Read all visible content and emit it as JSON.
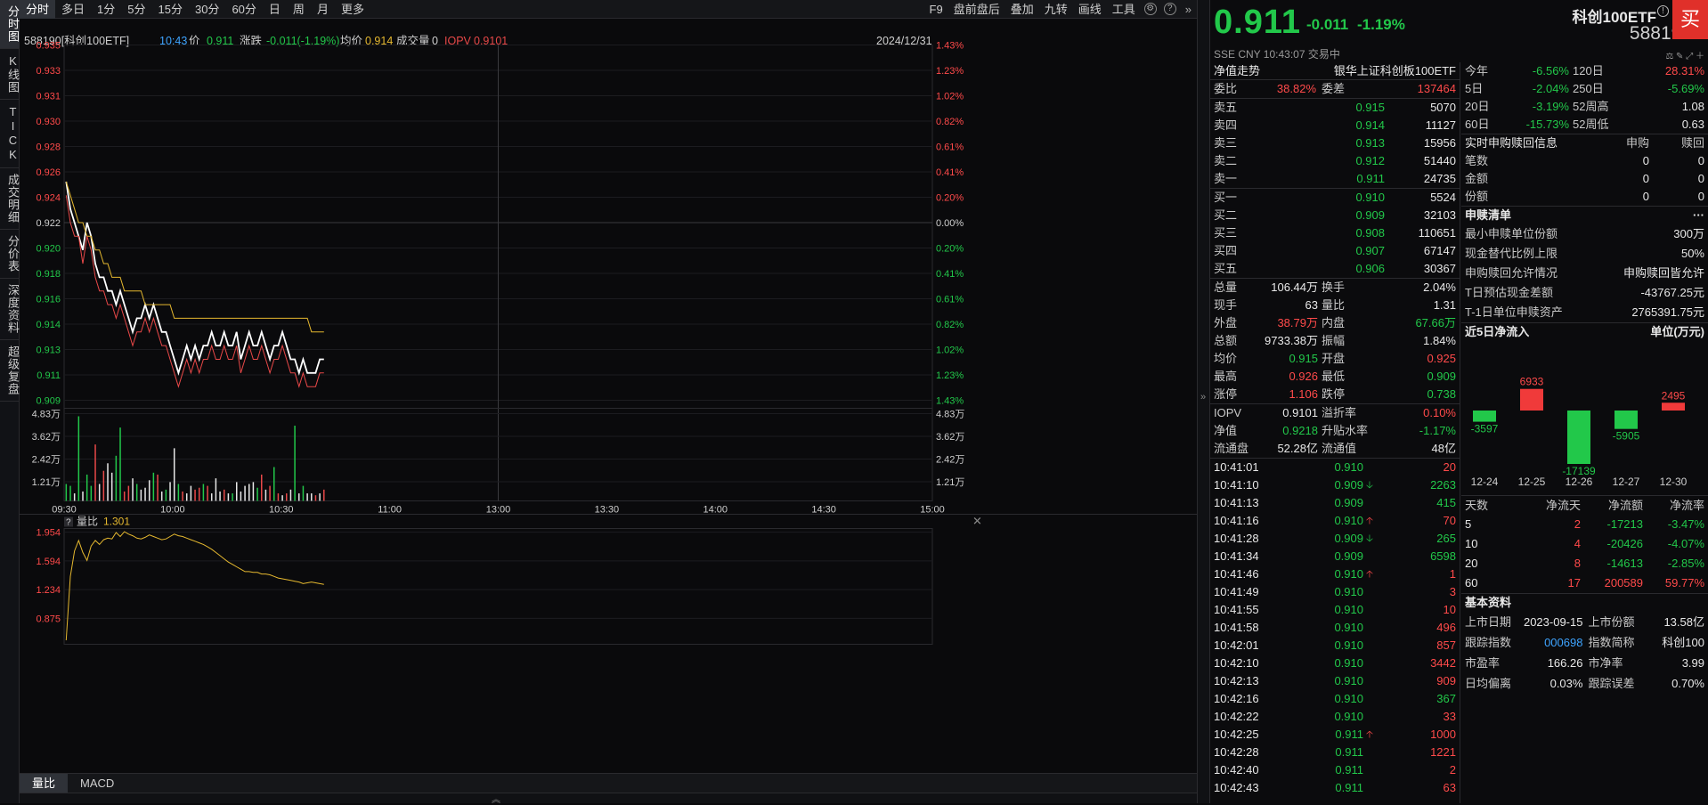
{
  "nav_left": [
    "分时图",
    "K线图",
    "TICK",
    "成交明细",
    "分价表",
    "深度资料",
    "超级复盘"
  ],
  "toolbar": {
    "periods": [
      "分时",
      "多日",
      "1分",
      "5分",
      "15分",
      "30分",
      "60分",
      "日",
      "周",
      "月",
      "更多"
    ],
    "right": [
      "F9",
      "盘前盘后",
      "叠加",
      "九转",
      "画线",
      "工具"
    ]
  },
  "infobar": {
    "code_name": "588190[科创100ETF]",
    "time": "10:43",
    "price_label": "价",
    "price": "0.911",
    "chg_label": "涨跌",
    "chg": "-0.011(-1.19%)",
    "avg_label": "均价",
    "avg": "0.914",
    "vol_label": "成交量",
    "vol": "0",
    "iopv_label": "IOPV",
    "iopv": "0.9101",
    "date": "2024/12/31"
  },
  "chart_data": [
    {
      "type": "line",
      "title": "分时",
      "y_left_ticks": [
        "0.935",
        "0.933",
        "0.931",
        "0.930",
        "0.928",
        "0.926",
        "0.924",
        "0.922",
        "0.920",
        "0.918",
        "0.916",
        "0.914",
        "0.913",
        "0.911",
        "0.909"
      ],
      "y_right_ticks": [
        "1.43%",
        "1.23%",
        "1.02%",
        "0.82%",
        "0.61%",
        "0.41%",
        "0.20%",
        "0.00%",
        "0.20%",
        "0.41%",
        "0.61%",
        "0.82%",
        "1.02%",
        "1.23%",
        "1.43%"
      ],
      "x_ticks": [
        "09:30",
        "10:00",
        "10:30",
        "11:00",
        "13:00",
        "13:30",
        "14:00",
        "14:30",
        "15:00"
      ],
      "ylim": [
        0.909,
        0.935
      ],
      "prev_close": 0.922,
      "series": [
        {
          "name": "价",
          "color": "#ffffff",
          "values": [
            0.925,
            0.923,
            0.922,
            0.921,
            0.92,
            0.922,
            0.921,
            0.919,
            0.918,
            0.918,
            0.917,
            0.917,
            0.916,
            0.917,
            0.916,
            0.915,
            0.914,
            0.915,
            0.915,
            0.916,
            0.915,
            0.916,
            0.915,
            0.914,
            0.914,
            0.913,
            0.912,
            0.911,
            0.912,
            0.913,
            0.912,
            0.913,
            0.912,
            0.913,
            0.913,
            0.914,
            0.913,
            0.913,
            0.914,
            0.913,
            0.913,
            0.914,
            0.912,
            0.913,
            0.914,
            0.913,
            0.913,
            0.914,
            0.913,
            0.912,
            0.913,
            0.913,
            0.914,
            0.913,
            0.912,
            0.912,
            0.911,
            0.912,
            0.911,
            0.911,
            0.911,
            0.912,
            0.912
          ]
        },
        {
          "name": "均价",
          "color": "#e5b82f",
          "values": [
            0.925,
            0.924,
            0.923,
            0.922,
            0.922,
            0.921,
            0.921,
            0.92,
            0.92,
            0.919,
            0.919,
            0.918,
            0.918,
            0.918,
            0.917,
            0.917,
            0.917,
            0.917,
            0.917,
            0.916,
            0.916,
            0.916,
            0.916,
            0.916,
            0.916,
            0.916,
            0.915,
            0.915,
            0.915,
            0.915,
            0.915,
            0.915,
            0.915,
            0.915,
            0.915,
            0.915,
            0.915,
            0.915,
            0.915,
            0.915,
            0.915,
            0.915,
            0.915,
            0.915,
            0.915,
            0.915,
            0.915,
            0.915,
            0.915,
            0.915,
            0.915,
            0.915,
            0.915,
            0.915,
            0.915,
            0.915,
            0.915,
            0.915,
            0.915,
            0.914,
            0.914,
            0.914,
            0.914
          ]
        },
        {
          "name": "IOPV",
          "color": "#e84848",
          "values": [
            0.924,
            0.922,
            0.921,
            0.921,
            0.919,
            0.921,
            0.92,
            0.918,
            0.917,
            0.917,
            0.916,
            0.916,
            0.915,
            0.916,
            0.915,
            0.914,
            0.913,
            0.914,
            0.914,
            0.915,
            0.914,
            0.915,
            0.914,
            0.913,
            0.913,
            0.912,
            0.911,
            0.91,
            0.911,
            0.912,
            0.911,
            0.912,
            0.911,
            0.912,
            0.912,
            0.913,
            0.912,
            0.912,
            0.913,
            0.912,
            0.912,
            0.913,
            0.911,
            0.912,
            0.913,
            0.912,
            0.912,
            0.913,
            0.912,
            0.911,
            0.912,
            0.912,
            0.913,
            0.912,
            0.911,
            0.911,
            0.91,
            0.911,
            0.91,
            0.91,
            0.91,
            0.911,
            0.911
          ]
        }
      ],
      "volume": {
        "y_ticks": [
          "4.83万",
          "3.62万",
          "2.42万",
          "1.21万"
        ],
        "ylim": [
          0,
          48300
        ],
        "values": [
          9000,
          8000,
          4000,
          45000,
          5000,
          14000,
          8000,
          30000,
          9000,
          16000,
          20000,
          15000,
          24000,
          39000,
          5000,
          8000,
          12000,
          9000,
          6000,
          7000,
          11000,
          15000,
          14000,
          5000,
          6000,
          10000,
          28000,
          9000,
          5000,
          4000,
          8000,
          6000,
          7000,
          9000,
          8000,
          4000,
          12000,
          5000,
          6000,
          4000,
          4000,
          10000,
          5000,
          8000,
          9000,
          10000,
          7000,
          14000,
          6000,
          8000,
          18000,
          4000,
          3000,
          4000,
          6000,
          40000,
          4000,
          8000,
          4000,
          4000,
          3000,
          4000,
          6000
        ],
        "colors": [
          "g",
          "g",
          "w",
          "g",
          "w",
          "g",
          "g",
          "r",
          "w",
          "r",
          "w",
          "w",
          "g",
          "g",
          "r",
          "r",
          "w",
          "g",
          "w",
          "w",
          "w",
          "g",
          "r",
          "w",
          "g",
          "w",
          "w",
          "g",
          "r",
          "w",
          "w",
          "r",
          "r",
          "g",
          "r",
          "w",
          "w",
          "w",
          "r",
          "w",
          "g",
          "w",
          "w",
          "w",
          "w",
          "w",
          "g",
          "r",
          "w",
          "r",
          "g",
          "r",
          "w",
          "r",
          "w",
          "g",
          "w",
          "g",
          "w",
          "w",
          "r",
          "w",
          "r"
        ]
      }
    },
    {
      "type": "line",
      "title": "量比",
      "series": [
        {
          "name": "量比",
          "color": "#e5b82f",
          "values": [
            0.6,
            1.4,
            1.72,
            1.85,
            1.7,
            1.6,
            1.78,
            1.85,
            1.8,
            1.86,
            1.88,
            1.87,
            1.95,
            1.9,
            1.96,
            1.93,
            1.91,
            1.88,
            1.87,
            1.89,
            1.92,
            1.9,
            1.88,
            1.86,
            1.87,
            1.9,
            1.93,
            1.91,
            1.9,
            1.88,
            1.86,
            1.84,
            1.82,
            1.8,
            1.77,
            1.74,
            1.7,
            1.66,
            1.62,
            1.58,
            1.55,
            1.52,
            1.49,
            1.46,
            1.46,
            1.45,
            1.45,
            1.43,
            1.43,
            1.42,
            1.4,
            1.38,
            1.37,
            1.36,
            1.35,
            1.34,
            1.33,
            1.31,
            1.32,
            1.33,
            1.32,
            1.31,
            1.3
          ]
        }
      ],
      "y_ticks": [
        "1.954",
        "1.594",
        "1.234",
        "0.875"
      ],
      "ylim": [
        0.55,
        2.0
      ],
      "label": "量比",
      "value": "1.301"
    }
  ],
  "bottom_tabs": [
    "量比",
    "MACD"
  ],
  "right": {
    "price": "0.911",
    "change": "-0.011",
    "change_pct": "-1.19%",
    "name": "科创100ETF",
    "code": "588190",
    "buy_label": "买",
    "sub_info": "SSE  CNY  10:43:07  交易中",
    "nav_title": "净值走势",
    "fund_title": "银华上证科创板100ETF",
    "weibi_label": "委比",
    "weibi": "38.82%",
    "weicha_label": "委差",
    "weicha": "137464",
    "asks": [
      {
        "l": "卖五",
        "p": "0.915",
        "v": "5070"
      },
      {
        "l": "卖四",
        "p": "0.914",
        "v": "11127"
      },
      {
        "l": "卖三",
        "p": "0.913",
        "v": "15956"
      },
      {
        "l": "卖二",
        "p": "0.912",
        "v": "51440"
      },
      {
        "l": "卖一",
        "p": "0.911",
        "v": "24735"
      }
    ],
    "bids": [
      {
        "l": "买一",
        "p": "0.910",
        "v": "5524"
      },
      {
        "l": "买二",
        "p": "0.909",
        "v": "32103"
      },
      {
        "l": "买三",
        "p": "0.908",
        "v": "110651"
      },
      {
        "l": "买四",
        "p": "0.907",
        "v": "67147"
      },
      {
        "l": "买五",
        "p": "0.906",
        "v": "30367"
      }
    ],
    "stats": [
      [
        {
          "k": "总量",
          "v": "106.44万",
          "c": "wht"
        },
        {
          "k": "换手",
          "v": "2.04%",
          "c": "wht"
        }
      ],
      [
        {
          "k": "现手",
          "v": "63",
          "c": "wht"
        },
        {
          "k": "量比",
          "v": "1.31",
          "c": "wht"
        }
      ],
      [
        {
          "k": "外盘",
          "v": "38.79万",
          "c": "red"
        },
        {
          "k": "内盘",
          "v": "67.66万",
          "c": "green"
        }
      ],
      [
        {
          "k": "总额",
          "v": "9733.38万",
          "c": "wht"
        },
        {
          "k": "振幅",
          "v": "1.84%",
          "c": "wht"
        }
      ],
      [
        {
          "k": "均价",
          "v": "0.915",
          "c": "green"
        },
        {
          "k": "开盘",
          "v": "0.925",
          "c": "red"
        }
      ],
      [
        {
          "k": "最高",
          "v": "0.926",
          "c": "red"
        },
        {
          "k": "最低",
          "v": "0.909",
          "c": "green"
        }
      ],
      [
        {
          "k": "涨停",
          "v": "1.106",
          "c": "red"
        },
        {
          "k": "跌停",
          "v": "0.738",
          "c": "green"
        }
      ]
    ],
    "stats2": [
      [
        {
          "k": "IOPV",
          "v": "0.9101",
          "c": "wht"
        },
        {
          "k": "溢折率",
          "v": "0.10%",
          "c": "red"
        }
      ],
      [
        {
          "k": "净值",
          "v": "0.9218",
          "c": "green"
        },
        {
          "k": "升贴水率",
          "v": "-1.17%",
          "c": "green"
        }
      ],
      [
        {
          "k": "流通盘",
          "v": "52.28亿",
          "c": "wht"
        },
        {
          "k": "流通值",
          "v": "48亿",
          "c": "wht"
        }
      ]
    ],
    "ticks": [
      {
        "t": "10:41:01",
        "p": "0.910",
        "a": "",
        "v": "20",
        "vc": "red"
      },
      {
        "t": "10:41:10",
        "p": "0.909",
        "a": "down",
        "v": "2263",
        "vc": "green"
      },
      {
        "t": "10:41:13",
        "p": "0.909",
        "a": "",
        "v": "415",
        "vc": "green"
      },
      {
        "t": "10:41:16",
        "p": "0.910",
        "a": "up",
        "v": "70",
        "vc": "red"
      },
      {
        "t": "10:41:28",
        "p": "0.909",
        "a": "down",
        "v": "265",
        "vc": "green"
      },
      {
        "t": "10:41:34",
        "p": "0.909",
        "a": "",
        "v": "6598",
        "vc": "green"
      },
      {
        "t": "10:41:46",
        "p": "0.910",
        "a": "up",
        "v": "1",
        "vc": "red"
      },
      {
        "t": "10:41:49",
        "p": "0.910",
        "a": "",
        "v": "3",
        "vc": "red"
      },
      {
        "t": "10:41:55",
        "p": "0.910",
        "a": "",
        "v": "10",
        "vc": "red"
      },
      {
        "t": "10:41:58",
        "p": "0.910",
        "a": "",
        "v": "496",
        "vc": "red"
      },
      {
        "t": "10:42:01",
        "p": "0.910",
        "a": "",
        "v": "857",
        "vc": "red"
      },
      {
        "t": "10:42:10",
        "p": "0.910",
        "a": "",
        "v": "3442",
        "vc": "red"
      },
      {
        "t": "10:42:13",
        "p": "0.910",
        "a": "",
        "v": "909",
        "vc": "red"
      },
      {
        "t": "10:42:16",
        "p": "0.910",
        "a": "",
        "v": "367",
        "vc": "green"
      },
      {
        "t": "10:42:22",
        "p": "0.910",
        "a": "",
        "v": "33",
        "vc": "red"
      },
      {
        "t": "10:42:25",
        "p": "0.911",
        "a": "up",
        "v": "1000",
        "vc": "red"
      },
      {
        "t": "10:42:28",
        "p": "0.911",
        "a": "",
        "v": "1221",
        "vc": "red"
      },
      {
        "t": "10:42:40",
        "p": "0.911",
        "a": "",
        "v": "2",
        "vc": "red"
      },
      {
        "t": "10:42:43",
        "p": "0.911",
        "a": "",
        "v": "63",
        "vc": "red"
      }
    ],
    "perf": [
      [
        {
          "k": "今年",
          "v": "-6.56%",
          "c": "green"
        },
        {
          "k": "120日",
          "v": "28.31%",
          "c": "red"
        }
      ],
      [
        {
          "k": "5日",
          "v": "-2.04%",
          "c": "green"
        },
        {
          "k": "250日",
          "v": "-5.69%",
          "c": "green"
        }
      ],
      [
        {
          "k": "20日",
          "v": "-3.19%",
          "c": "green"
        },
        {
          "k": "52周高",
          "v": "1.08",
          "c": "wht"
        }
      ],
      [
        {
          "k": "60日",
          "v": "-15.73%",
          "c": "green"
        },
        {
          "k": "52周低",
          "v": "0.63",
          "c": "wht"
        }
      ]
    ],
    "sg_title": "实时申购赎回信息",
    "sg_headers": [
      "申购",
      "赎回"
    ],
    "sg_rows": [
      {
        "k": "笔数",
        "a": "0",
        "b": "0"
      },
      {
        "k": "金额",
        "a": "0",
        "b": "0"
      },
      {
        "k": "份额",
        "a": "0",
        "b": "0"
      }
    ],
    "sl_title": "申赎清单",
    "sl_more": "···",
    "sl_rows": [
      {
        "k": "最小申赎单位份额",
        "v": "300万"
      },
      {
        "k": "现金替代比例上限",
        "v": "50%"
      },
      {
        "k": "申购赎回允许情况",
        "v": "申购赎回皆允许"
      },
      {
        "k": "T日预估现金差额",
        "v": "-43767.25元"
      },
      {
        "k": "T-1日单位申赎资产",
        "v": "2765391.75元"
      }
    ],
    "flow_title": "近5日净流入",
    "flow_unit": "单位(万元)",
    "flow_chart": {
      "type": "bar",
      "categories": [
        "12-24",
        "12-25",
        "12-26",
        "12-27",
        "12-30"
      ],
      "values": [
        -3597,
        6933,
        -17139,
        -5905,
        2495
      ]
    },
    "flow_headers": [
      "天数",
      "净流天",
      "净流额",
      "净流率"
    ],
    "flow_rows": [
      {
        "d": "5",
        "n": "2",
        "a": "-17213",
        "r": "-3.47%"
      },
      {
        "d": "10",
        "n": "4",
        "a": "-20426",
        "r": "-4.07%"
      },
      {
        "d": "20",
        "n": "8",
        "a": "-14613",
        "r": "-2.85%"
      },
      {
        "d": "60",
        "n": "17",
        "a": "200589",
        "r": "59.77%"
      }
    ],
    "basic_title": "基本资料",
    "basic_rows": [
      [
        {
          "k": "上市日期",
          "v": "2023-09-15",
          "c": "wht"
        },
        {
          "k": "上市份额",
          "v": "13.58亿",
          "c": "wht"
        }
      ],
      [
        {
          "k": "跟踪指数",
          "v": "000698",
          "c": "blu"
        },
        {
          "k": "指数简称",
          "v": "科创100",
          "c": "wht"
        }
      ],
      [
        {
          "k": "市盈率",
          "v": "166.26",
          "c": "wht"
        },
        {
          "k": "市净率",
          "v": "3.99",
          "c": "wht"
        }
      ],
      [
        {
          "k": "日均偏离",
          "v": "0.03%",
          "c": "wht"
        },
        {
          "k": "跟踪误差",
          "v": "0.70%",
          "c": "wht"
        }
      ]
    ]
  }
}
